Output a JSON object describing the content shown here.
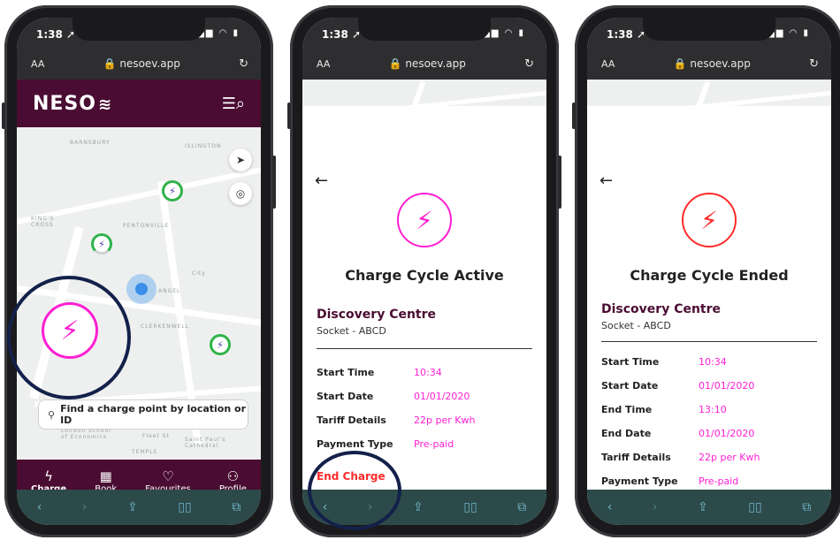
{
  "status_time": "1:38",
  "safari": {
    "text_size": "AA",
    "url": "nesoev.app"
  },
  "phone1": {
    "logo": "NESO",
    "map_labels": [
      "BARNSBURY",
      "ISLINGTON",
      "KING'S CROSS",
      "PENTONVILLE",
      "ANGEL",
      "CLERKENWELL",
      "City",
      "London School of Economics",
      "TEMPLE",
      "Saint Paul's Cathedral",
      "Fleet St"
    ],
    "search_placeholder": "Find a charge point by location or ID",
    "tabs": [
      {
        "icon": "lightning-icon",
        "label": "Charge",
        "active": true
      },
      {
        "icon": "calendar-icon",
        "label": "Book",
        "active": false
      },
      {
        "icon": "heart-icon",
        "label": "Favourites",
        "active": false
      },
      {
        "icon": "person-icon",
        "label": "Profile",
        "active": false
      }
    ]
  },
  "phone2": {
    "title": "Charge Cycle Active",
    "icon_color": "#ff1fd2",
    "site": "Discovery Centre",
    "socket": "Socket - ABCD",
    "details": [
      {
        "label": "Start Time",
        "value": "10:34"
      },
      {
        "label": "Start Date",
        "value": "01/01/2020"
      },
      {
        "label": "Tariff Details",
        "value": "22p per Kwh"
      },
      {
        "label": "Payment Type",
        "value": "Pre-paid"
      }
    ],
    "end_charge": "End Charge"
  },
  "phone3": {
    "title": "Charge Cycle Ended",
    "icon_color": "#ff2a2a",
    "site": "Discovery Centre",
    "socket": "Socket - ABCD",
    "details": [
      {
        "label": "Start Time",
        "value": "10:34"
      },
      {
        "label": "Start Date",
        "value": "01/01/2020"
      },
      {
        "label": "End Time",
        "value": "13:10"
      },
      {
        "label": "End Date",
        "value": "01/01/2020"
      },
      {
        "label": "Tariff Details",
        "value": "22p per Kwh"
      },
      {
        "label": "Payment Type",
        "value": "Pre-paid"
      }
    ]
  },
  "colors": {
    "brand": "#4a0c32",
    "accent": "#ff1fd2",
    "ended": "#ff2a2a",
    "highlight_ring": "#13214a"
  }
}
